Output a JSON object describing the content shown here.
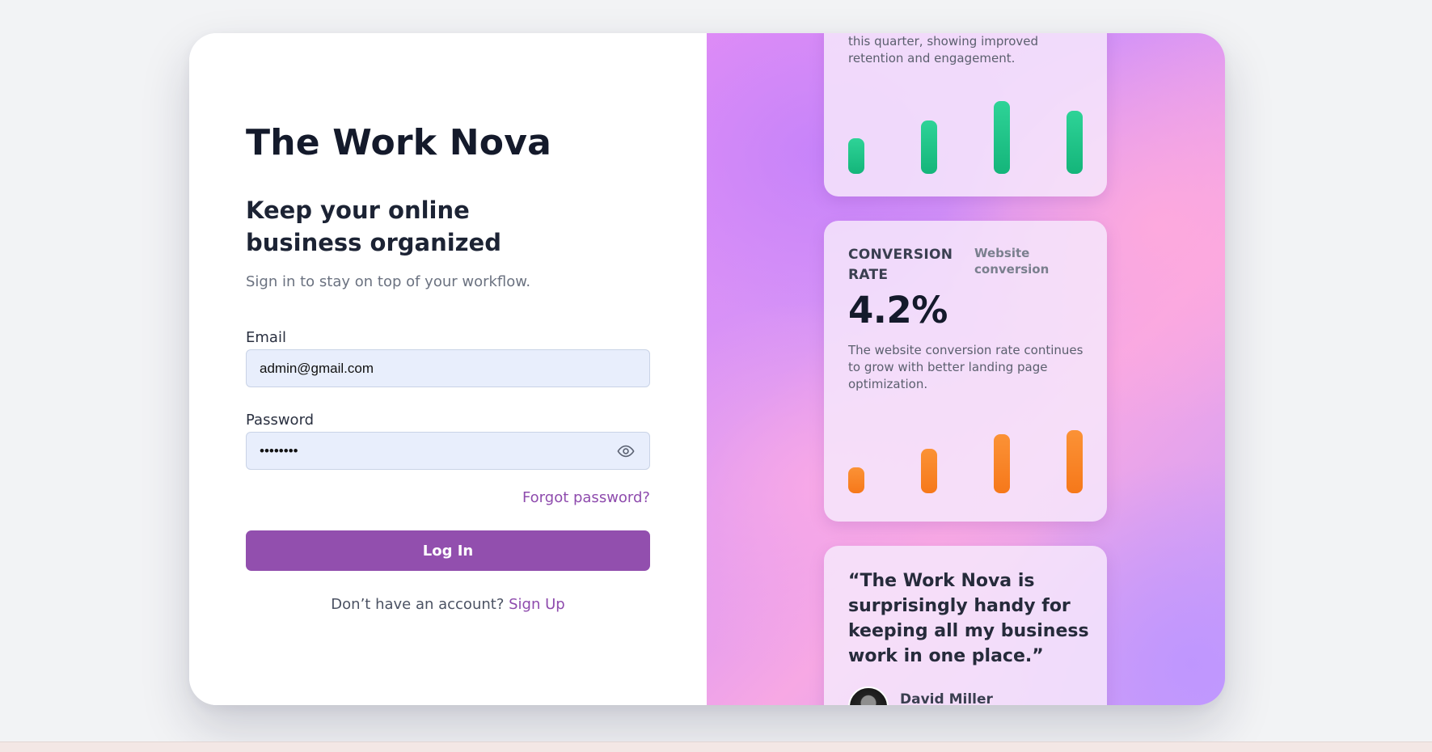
{
  "brand": {
    "title": "The Work Nova"
  },
  "login": {
    "headline": "Keep your online business organized",
    "subtext": "Sign in to stay on top of your workflow.",
    "email_label": "Email",
    "email_value": "admin@gmail.com",
    "password_label": "Password",
    "password_value": "••••••••",
    "forgot_label": "Forgot password?",
    "login_button": "Log In",
    "signup_prompt": "Don’t have an account?",
    "signup_link": "Sign Up"
  },
  "cards": {
    "engagement": {
      "description": "this quarter, showing improved retention and engagement.",
      "bars": [
        0.43,
        0.65,
        0.88,
        0.76
      ],
      "bar_color": "#1dbf84"
    },
    "conversion": {
      "metric_label": "CONVERSION RATE",
      "side_label": "Website conversion",
      "value": "4.2%",
      "description": "The website conversion rate continues to grow with better landing page optimization.",
      "bars": [
        0.36,
        0.62,
        0.82,
        0.88
      ],
      "bar_color": "#f7801f"
    },
    "testimonial": {
      "quote": "“The Work Nova is surprisingly handy for keeping all my business work in one place.”",
      "author": "David Miller"
    }
  },
  "icons": {
    "password_toggle": "eye-icon",
    "author_avatar": "avatar-photo"
  },
  "colors": {
    "accent": "#924fae",
    "link": "#8e4bad",
    "input_bg": "#e8eefc"
  }
}
